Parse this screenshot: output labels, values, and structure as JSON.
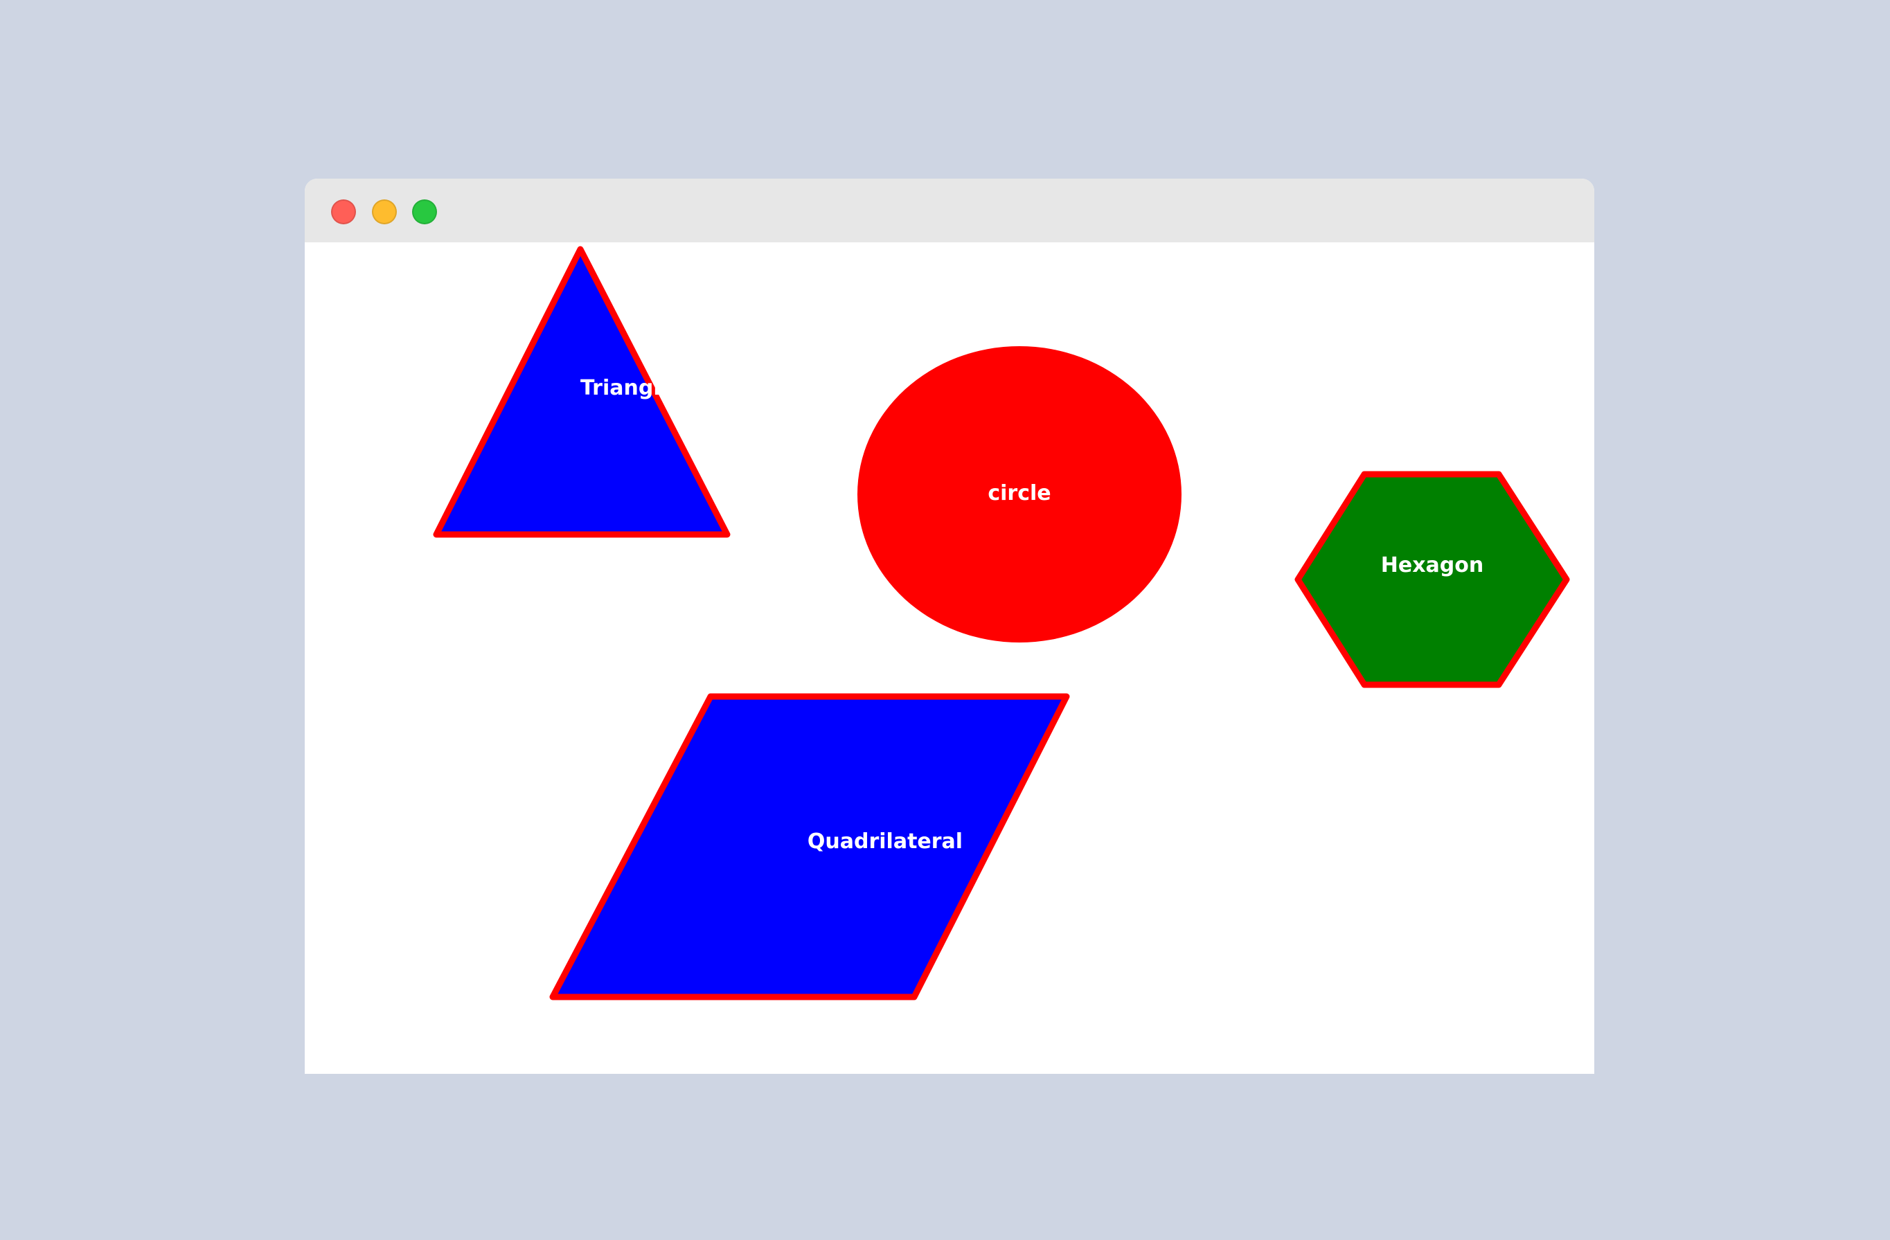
{
  "window": {
    "controls": {
      "close_color": "#ff5f57",
      "minimize_color": "#febc2e",
      "zoom_color": "#28c840"
    }
  },
  "canvas": {
    "outline_color": "#ff0000",
    "label_color": "#ffffff",
    "shapes": {
      "triangle": {
        "label": "Triangle",
        "fill": "#0000ff"
      },
      "circle": {
        "label": "circle",
        "fill": "#ff0000"
      },
      "hexagon": {
        "label": "Hexagon",
        "fill": "#008000"
      },
      "quadrilateral": {
        "label": "Quadrilateral",
        "fill": "#0000ff"
      }
    }
  }
}
